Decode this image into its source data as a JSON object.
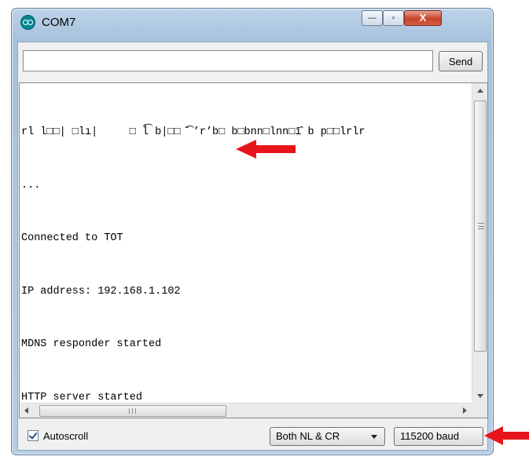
{
  "window": {
    "title": "COM7",
    "controls": {
      "minimize": "—",
      "maximize": "▫",
      "close": "X"
    }
  },
  "input": {
    "value": "",
    "placeholder": ""
  },
  "send_button": {
    "label": "Send"
  },
  "output": {
    "lines": [
      "rl l□□| □lı|     □ l̂͡ b|□□ ̂͡ ’r’b□ b□bnn□lnn□ī̂ b p□□lrlr",
      "...",
      "Connected to TOT",
      "IP address: 192.168.1.102",
      "MDNS responder started",
      "HTTP server started"
    ]
  },
  "autoscroll": {
    "label": "Autoscroll",
    "checked": true
  },
  "line_ending": {
    "selected": "Both NL & CR"
  },
  "baud": {
    "selected": "115200 baud"
  },
  "icons": {
    "app": "arduino-icon",
    "annotation": "red-arrow-icon"
  },
  "colors": {
    "annotation": "#e8141b",
    "app_icon": "#00878f"
  }
}
